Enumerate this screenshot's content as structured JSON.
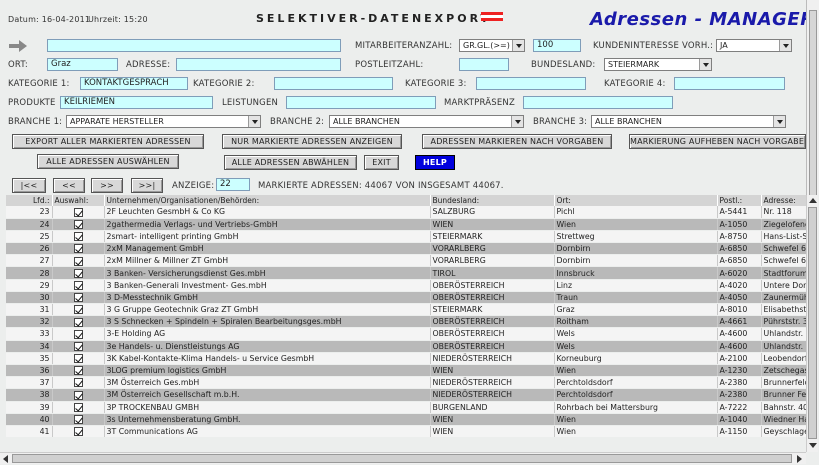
{
  "header": {
    "datum_label": "Datum: 16-04-2011",
    "uhrzeit_label": "Uhrzeit: 15:20",
    "logo_text": "SELEKTIVER-DATENEXPORT",
    "app_title": "Adressen - MANAGER",
    "flag_colors": [
      "#ee2222",
      "#ffffff",
      "#ee2222"
    ]
  },
  "filters": {
    "search_value": "",
    "mitarbeiteranzahl_label": "MITARBEITERANZAHL:",
    "mitarbeiteranzahl_op": "GR.GL.(>=)",
    "mitarbeiteranzahl_value": "100",
    "kundeninteresse_label": "KUNDENINTERESSE VORH.:",
    "kundeninteresse_value": "JA",
    "ort_label": "ORT:",
    "ort_value": "Graz",
    "adresse_label": "ADRESSE:",
    "adresse_value": "",
    "postleitzahl_label": "POSTLEITZAHL:",
    "postleitzahl_value": "",
    "bundesland_label": "BUNDESLAND:",
    "bundesland_value": "STEIERMARK",
    "kategorie1_label": "KATEGORIE 1:",
    "kategorie1_value": "KONTAKTGESPRÄCH",
    "kategorie2_label": "KATEGORIE 2:",
    "kategorie2_value": "",
    "kategorie3_label": "KATEGORIE 3:",
    "kategorie3_value": "",
    "kategorie4_label": "KATEGORIE 4:",
    "kategorie4_value": "",
    "produkte_label": "PRODUKTE",
    "produkte_value": "KEILRIEMEN",
    "leistungen_label": "LEISTUNGEN",
    "leistungen_value": "",
    "marktpraesenz_label": "MARKTPRÄSENZ",
    "marktpraesenz_value": "",
    "branche1_label": "BRANCHE 1:",
    "branche1_value": "APPARATE HERSTELLER",
    "branche2_label": "BRANCHE 2:",
    "branche2_value": "ALLE BRANCHEN",
    "branche3_label": "BRANCHE 3:",
    "branche3_value": "ALLE BRANCHEN"
  },
  "buttons": {
    "export": "EXPORT ALLER MARKIERTEN ADRESSEN",
    "nur_markierte": "NUR MARKIERTE ADRESSEN ANZEIGEN",
    "markieren_nach": "ADRESSEN MARKIEREN NACH VORGABEN",
    "markierung_aufheben": "MARKIERUNG AUFHEBEN NACH VORGABEN",
    "alle_auswaehlen": "ALLE ADRESSEN AUSWÄHLEN",
    "alle_abwaehlen": "ALLE ADRESSEN ABWÄHLEN",
    "exit": "EXIT",
    "help": "HELP"
  },
  "pagination": {
    "first": "|<<",
    "prev": "<<",
    "next": ">>",
    "last": ">>|",
    "anzeige_label": "ANZEIGE:",
    "anzeige_value": "22",
    "summary": "MARKIERTE ADRESSEN: 44067 VON INSGESAMT 44067."
  },
  "table": {
    "headers": [
      "Lfd.:",
      "Auswahl:",
      "Unternehmen/Organisationen/Behörden:",
      "Bundesland:",
      "Ort:",
      "Postl.:",
      "Adresse:"
    ],
    "rows": [
      [
        "23",
        "2F Leuchten GesmbH & Co KG",
        "SALZBURG",
        "Pichl",
        "A-5441",
        "Nr. 118"
      ],
      [
        "24",
        "2gathermedia Verlags- und Vertriebs-GmbH",
        "WIEN",
        "Wien",
        "A-1050",
        "Ziegelofeng"
      ],
      [
        "25",
        "2smart- intelligent printing GmbH",
        "STEIERMARK",
        "Strettweg",
        "A-8750",
        "Hans-List-S"
      ],
      [
        "26",
        "2xM Management GmbH",
        "VORARLBERG",
        "Dornbirn",
        "A-6850",
        "Schwefel 68"
      ],
      [
        "27",
        "2xM Millner & Millner ZT GmbH",
        "VORARLBERG",
        "Dornbirn",
        "A-6850",
        "Schwefel 68"
      ],
      [
        "28",
        "3 Banken- Versicherungsdienst Ges.mbH",
        "TIROL",
        "Innsbruck",
        "A-6020",
        "Stadtforum"
      ],
      [
        "29",
        "3 Banken-Generali Investment- Ges.mbH",
        "OBERÖSTERREICH",
        "Linz",
        "A-4020",
        "Untere Don"
      ],
      [
        "30",
        "3 D-Messtechnik GmbH",
        "OBERÖSTERREICH",
        "Traun",
        "A-4050",
        "Zaunermüh"
      ],
      [
        "31",
        "3 G Gruppe Geotechnik Graz ZT GmbH",
        "STEIERMARK",
        "Graz",
        "A-8010",
        "Elisabethst"
      ],
      [
        "32",
        "3 S Schnecken + Spindeln + Spiralen Bearbeitungsges.mbH",
        "OBERÖSTERREICH",
        "Roitham",
        "A-4661",
        "Pührststr. 3"
      ],
      [
        "33",
        "3-E Holding AG",
        "OBERÖSTERREICH",
        "Wels",
        "A-4600",
        "Uhlandstr. 3"
      ],
      [
        "34",
        "3e Handels- u. Dienstleistungs AG",
        "OBERÖSTERREICH",
        "Wels",
        "A-4600",
        "Uhlandstr. 3"
      ],
      [
        "35",
        "3K Kabel-Kontakte-Klima Handels- u Service GesmbH",
        "NIEDERÖSTERREICH",
        "Korneuburg",
        "A-2100",
        "Leobendorfe"
      ],
      [
        "36",
        "3LOG premium logistics GmbH",
        "WIEN",
        "Wien",
        "A-1230",
        "Zetschegas"
      ],
      [
        "37",
        "3M Österreich Ges.mbH",
        "NIEDERÖSTERREICH",
        "Perchtoldsdorf",
        "A-2380",
        "Brunnerfeld"
      ],
      [
        "38",
        "3M Österreich Gesellschaft m.b.H.",
        "NIEDERÖSTERREICH",
        "Perchtoldsdorf",
        "A-2380",
        "Brunner Fel"
      ],
      [
        "39",
        "3P TROCKENBAU GMBH",
        "BURGENLAND",
        "Rohrbach bei Mattersburg",
        "A-7222",
        "Bahnstr. 40"
      ],
      [
        "40",
        "3s Unternehmensberatung GmbH.",
        "WIEN",
        "Wien",
        "A-1040",
        "Wiedner Ha"
      ],
      [
        "41",
        "3T Communications AG",
        "WIEN",
        "Wien",
        "A-1150",
        "Geyschlage"
      ]
    ]
  }
}
